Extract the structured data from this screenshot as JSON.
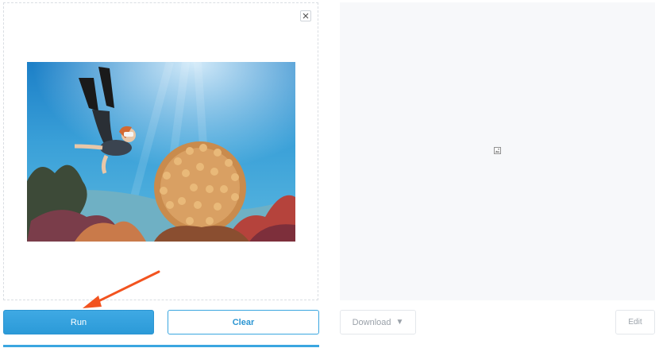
{
  "input": {
    "close_icon": "close-icon",
    "image_alt": "Free diver swimming over a coral reef"
  },
  "output": {
    "placeholder_icon": "image-icon"
  },
  "actions": {
    "run_label": "Run",
    "clear_label": "Clear",
    "download_label": "Download",
    "download_caret": "▼",
    "edit_label": "Edit"
  },
  "colors": {
    "accent": "#3aa6e0",
    "annotation_arrow": "#f2531f"
  }
}
